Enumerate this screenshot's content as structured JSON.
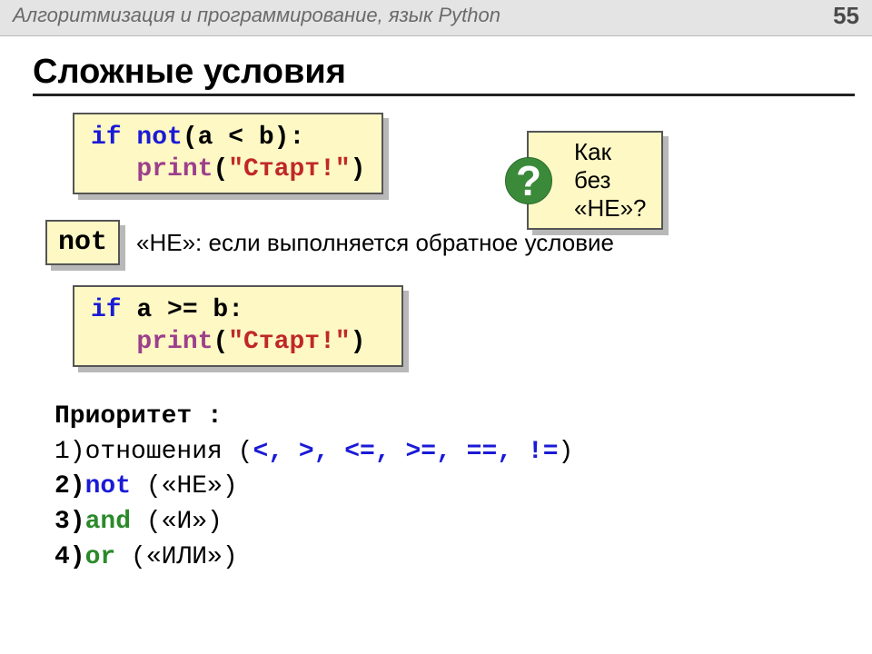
{
  "header": {
    "title": "Алгоритмизация и программирование, язык Python",
    "page": "55"
  },
  "slide_title": "Сложные условия",
  "code1": {
    "kw_if": "if",
    "kw_not": "not",
    "expr": "(a < b):",
    "indent": "   ",
    "fn": "print",
    "open": "(",
    "str": "\"Старт!\"",
    "close": ")"
  },
  "callout": {
    "q": "?",
    "text": "Как без «НЕ»?"
  },
  "not_label": "not",
  "not_desc": "«НЕ»: если выполняется обратное условие",
  "code2": {
    "kw_if": "if",
    "expr": " a >= b:",
    "indent": "   ",
    "fn": "print",
    "open": "(",
    "str": "\"Старт!\"",
    "close": ")"
  },
  "priority": {
    "heading": "Приоритет :",
    "l1a": "1)отношения (",
    "l1ops": "<, >, <=, >=, ==, !=",
    "l1b": ")",
    "l2a": "2)",
    "l2kw": "not",
    "l2b": " («НЕ»)",
    "l3a": "3)",
    "l3kw": "and",
    "l3b": " («И»)",
    "l4a": "4)",
    "l4kw": "or",
    "l4b": " («ИЛИ»)"
  }
}
